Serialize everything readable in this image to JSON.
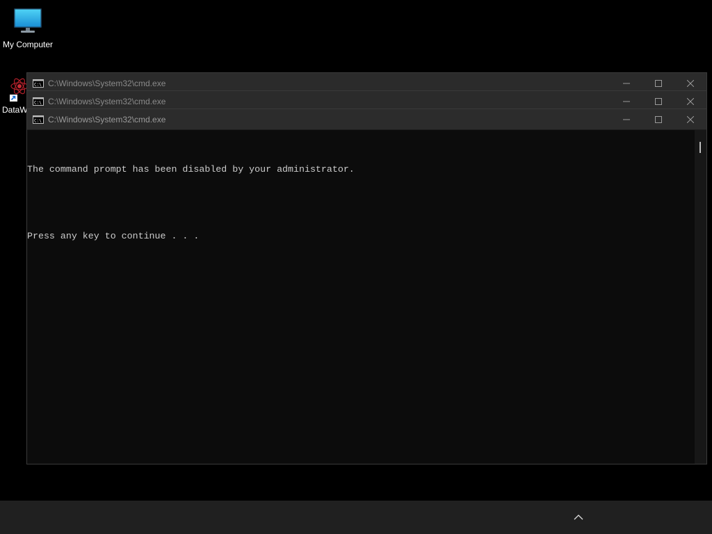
{
  "desktop": {
    "icons": [
      {
        "label": "My Computer",
        "icon": "monitor-icon"
      },
      {
        "label": "DataW",
        "icon": "dataw-app-icon"
      }
    ]
  },
  "windows": [
    {
      "title": "C:\\Windows\\System32\\cmd.exe",
      "icon": "cmd-icon"
    },
    {
      "title": "C:\\Windows\\System32\\cmd.exe",
      "icon": "cmd-icon"
    },
    {
      "title": "C:\\Windows\\System32\\cmd.exe",
      "icon": "cmd-icon"
    }
  ],
  "console": {
    "lines": [
      "The command prompt has been disabled by your administrator.",
      "Press any key to continue . . ."
    ]
  },
  "window_controls": {
    "minimize": "minimize-icon",
    "maximize": "maximize-icon",
    "close": "close-icon"
  },
  "taskbar": {
    "tray_icon": "chevron-up-icon"
  },
  "colors": {
    "desktop_bg": "#000000",
    "titlebar_bg": "#2b2b2b",
    "console_bg": "#0c0c0c",
    "console_text": "#cccccc",
    "taskbar_bg": "#202020"
  }
}
